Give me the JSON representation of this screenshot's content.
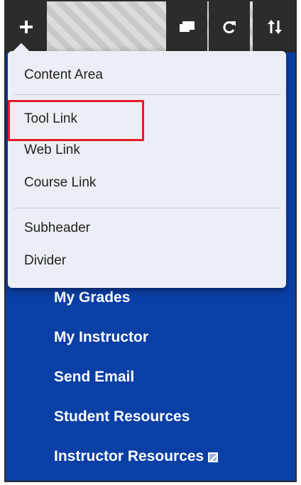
{
  "toolbar": {
    "add_icon": "plus-icon",
    "manage_icon": "display-icon",
    "refresh_icon": "refresh-icon",
    "sort_icon": "sort-icon"
  },
  "add_menu": {
    "items": [
      {
        "label": "Content Area"
      },
      {
        "label": "Tool Link",
        "highlighted": true
      },
      {
        "label": "Web Link"
      },
      {
        "label": "Course Link"
      },
      {
        "label": "Subheader"
      },
      {
        "label": "Divider"
      }
    ]
  },
  "course_menu": {
    "items": [
      {
        "label": "My Grades"
      },
      {
        "label": "My Instructor"
      },
      {
        "label": "Send Email"
      },
      {
        "label": "Student Resources"
      },
      {
        "label": "Instructor Resources",
        "icon": "hidden-from-students-icon"
      }
    ]
  },
  "colors": {
    "course_menu_bg": "#0a3fa6",
    "toolbar_button_bg": "#2c2c2c",
    "dropdown_bg": "#eceef5",
    "highlight_border": "#e8192c"
  }
}
